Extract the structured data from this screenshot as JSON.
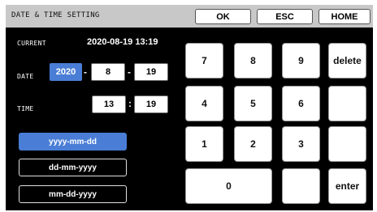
{
  "header": {
    "title": "DATE & TIME SETTING",
    "ok_label": "OK",
    "esc_label": "ESC",
    "home_label": "HOME"
  },
  "current": {
    "label": "CURRENT",
    "value": "2020-08-19 13:19"
  },
  "date": {
    "label": "DATE",
    "year": "2020",
    "month": "8",
    "day": "19",
    "separator": "-"
  },
  "time": {
    "label": "TIME",
    "hour": "13",
    "minute": "19",
    "separator": ":"
  },
  "formats": {
    "options": [
      "yyyy-mm-dd",
      "dd-mm-yyyy",
      "mm-dd-yyyy"
    ],
    "selected": "yyyy-mm-dd"
  },
  "keypad": {
    "k7": "7",
    "k8": "8",
    "k9": "9",
    "delete": "delete",
    "k4": "4",
    "k5": "5",
    "k6": "6",
    "k1": "1",
    "k2": "2",
    "k3": "3",
    "k0": "0",
    "enter": "enter"
  },
  "colors": {
    "accent": "#4a7ed6",
    "title_bar": "#c8c8c8",
    "panel": "#000000"
  }
}
